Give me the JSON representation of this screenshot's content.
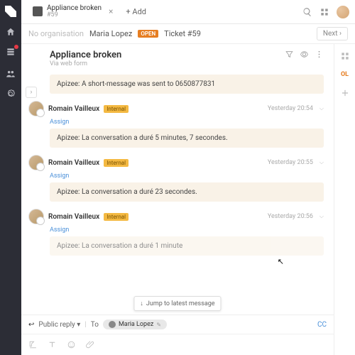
{
  "tab": {
    "title": "Appliance broken",
    "sub": "#59",
    "add": "+ Add"
  },
  "breadcrumb": {
    "noorg": "No organisation",
    "user": "Maria Lopez",
    "open": "OPEN",
    "ticket": "Ticket #59",
    "next": "Next ›"
  },
  "header": {
    "title": "Appliance broken",
    "via": "Via web form"
  },
  "messages": {
    "first_note": "Apizee: A short-message was sent to 0650877831",
    "items": [
      {
        "who": "Romain Vailleux",
        "tag": "Internal",
        "assign": "Assign",
        "time": "Yesterday 20:54",
        "body": "Apizee: La conversation a duré 5 minutes, 7 secondes."
      },
      {
        "who": "Romain Vailleux",
        "tag": "Internal",
        "assign": "Assign",
        "time": "Yesterday 20:55",
        "body": "Apizee: La conversation a duré 23 secondes."
      },
      {
        "who": "Romain Vailleux",
        "tag": "Internal",
        "assign": "Assign",
        "time": "Yesterday 20:56",
        "body": "Apizee: La conversation a duré 1 minute"
      }
    ]
  },
  "jump": "Jump to latest message",
  "reply": {
    "arrow": "↩",
    "mode": "Public reply",
    "to": "To",
    "recipient": "Maria Lopez",
    "cc": "CC"
  },
  "rside": {
    "ol": "OL"
  }
}
